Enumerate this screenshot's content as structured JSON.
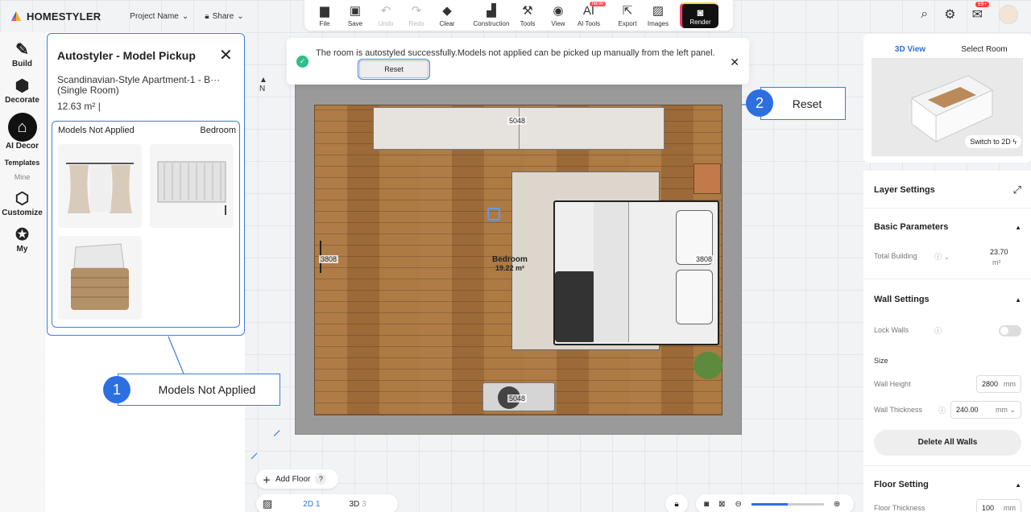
{
  "app": {
    "name": "HOMESTYLER",
    "project_name": "Project Name",
    "share": "Share"
  },
  "toolbar": [
    {
      "label": "File",
      "icon": "folder-icon",
      "glyph": "▆",
      "disabled": false
    },
    {
      "label": "Save",
      "icon": "save-icon",
      "glyph": "▣",
      "disabled": false
    },
    {
      "label": "Undo",
      "icon": "undo-icon",
      "glyph": "↶",
      "disabled": true
    },
    {
      "label": "Redo",
      "icon": "redo-icon",
      "glyph": "↷",
      "disabled": true
    },
    {
      "label": "Clear",
      "icon": "eraser-icon",
      "glyph": "◆",
      "disabled": false
    },
    {
      "label": "Construction",
      "icon": "construction-icon",
      "glyph": "▟",
      "disabled": false
    },
    {
      "label": "Tools",
      "icon": "tools-icon",
      "glyph": "⚒",
      "disabled": false
    },
    {
      "label": "View",
      "icon": "eye-icon",
      "glyph": "◉",
      "disabled": false
    },
    {
      "label": "AI Tools",
      "icon": "ai-icon",
      "glyph": "AI",
      "disabled": false,
      "badge": "NEW"
    },
    {
      "label": "Export",
      "icon": "export-icon",
      "glyph": "⇱",
      "disabled": false
    },
    {
      "label": "Images",
      "icon": "image-icon",
      "glyph": "▨",
      "disabled": false
    }
  ],
  "render_label": "Render",
  "notifications_badge": "99+",
  "left_rail": {
    "items": [
      {
        "label": "Build",
        "icon": "build-icon",
        "glyph": "✎"
      },
      {
        "label": "Decorate",
        "icon": "decorate-icon",
        "glyph": "⬢"
      },
      {
        "label": "AI Decor",
        "icon": "ai-decor-icon",
        "glyph": "⌂",
        "active": true
      }
    ],
    "templates": "Templates",
    "mine": "Mine",
    "items2": [
      {
        "label": "Customize",
        "icon": "cube-icon",
        "glyph": "⬡"
      },
      {
        "label": "My",
        "icon": "star-icon",
        "glyph": "✪"
      }
    ]
  },
  "panel": {
    "title": "Autostyler - Model Pickup",
    "subtitle": "Scandinavian-Style Apartment-1 - B··· (Single Room)",
    "area": "12.63 m²  |",
    "models_header": "Models Not Applied",
    "room_filter": "Bedroom"
  },
  "notice": {
    "text": "The room is autostyled successfully.Models not applied can be picked up manually from the left panel.",
    "reset": "Reset"
  },
  "callouts": [
    {
      "num": "1",
      "label": "Models Not Applied"
    },
    {
      "num": "2",
      "label": "Reset"
    }
  ],
  "plan": {
    "compass": "N",
    "dim_top": "5048",
    "dim_bottom": "5048",
    "dim_left": "3808",
    "dim_right": "3808",
    "room_name": "Bedroom",
    "room_area": "19.22 m²"
  },
  "preview": {
    "tab_3d": "3D View",
    "tab_select": "Select Room",
    "switch": "Switch to 2D"
  },
  "settings": {
    "layer": "Layer Settings",
    "basic": "Basic Parameters",
    "total_building_label": "Total Building",
    "total_building_value": "23.70",
    "total_building_unit": "m²",
    "wall_settings": "Wall Settings",
    "lock_walls": "Lock Walls",
    "size": "Size",
    "wall_height_label": "Wall Height",
    "wall_height_value": "2800",
    "wall_height_unit": "mm",
    "wall_thickness_label": "Wall Thickness",
    "wall_thickness_value": "240.00",
    "wall_thickness_unit": "mm",
    "delete_walls": "Delete All Walls",
    "floor_setting": "Floor Setting",
    "floor_thickness_label": "Floor Thickness",
    "floor_thickness_value": "100",
    "floor_thickness_unit": "mm"
  },
  "bottom": {
    "add_floor": "Add Floor",
    "help": "?",
    "view_2d": "2D",
    "view_2d_num": "1",
    "view_3d": "3D",
    "view_3d_num": "3",
    "zoom_level": 0.5
  },
  "colors": {
    "accent": "#2d6fe0",
    "callout_border": "#3b7ddd",
    "success": "#2dbf8a",
    "badge": "#ff3b30"
  }
}
